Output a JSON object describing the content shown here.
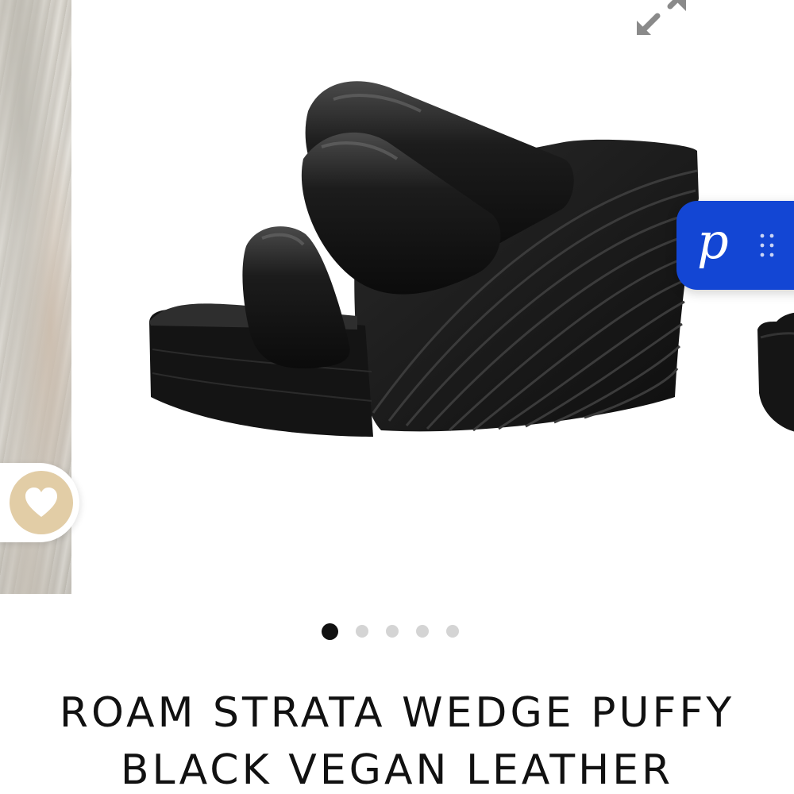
{
  "product": {
    "title_line1": "ROAM STRATA WEDGE PUFFY",
    "title_line2": "BLACK VEGAN LEATHER"
  },
  "gallery": {
    "image_count": 5,
    "active_index": 0,
    "main_image_icon": "wedge-sandal-image",
    "expand_icon": "expand-icon"
  },
  "widget": {
    "letter": "p",
    "grip_icon": "drag-grip-icon",
    "color": "#1346d4"
  },
  "favorite": {
    "icon": "heart-icon",
    "color": "#e2cda6"
  }
}
